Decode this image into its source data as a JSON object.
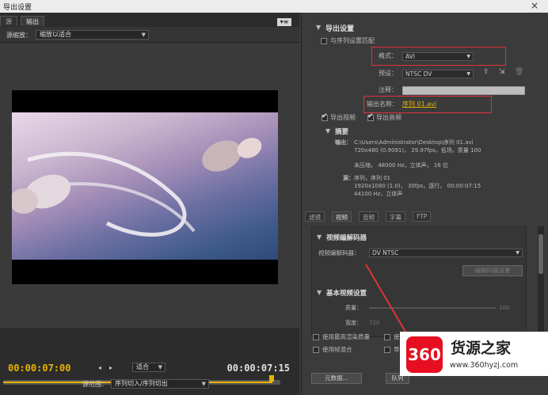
{
  "window": {
    "title": "导出设置",
    "close": "×"
  },
  "left": {
    "tabs": [
      "源",
      "输出"
    ],
    "source_scaling": {
      "label": "源缩放：",
      "value": "缩放以适合"
    },
    "controls": {
      "timecode_in": "00:00:07:00",
      "timecode_out": "00:00:07:15",
      "fit": "适合",
      "range_label": "源范围：",
      "range_value": "序列切入/序列切出"
    }
  },
  "export_settings": {
    "header": "导出设置",
    "match_sequence": "与序列设置匹配",
    "format_label": "格式：",
    "format_value": "AVI",
    "preset_label": "预设：",
    "preset_value": "NTSC DV",
    "comment_label": "注释：",
    "output_name_label": "输出名称：",
    "output_name_value": "序列 01.avi",
    "export_video": "导出视频",
    "export_audio": "导出音频"
  },
  "summary": {
    "header": "摘要",
    "output_label": "输出：",
    "output_lines": [
      "C:\\Users\\Administrator\\Desktop\\序列 01.avi",
      "720x480 (0.9091)， 29.97fps，低场，质量 100",
      "",
      "未压缩， 48000 Hz，立体声， 16 位"
    ],
    "source_label": "源：",
    "source_lines": [
      "序列，序列 01",
      "1920x1080 (1.0)， 30fps，逐行， 00:00:07:15",
      "44100 Hz，立体声"
    ]
  },
  "tabs": [
    "滤镜",
    "视频",
    "音频",
    "字幕",
    "FTP"
  ],
  "video_codec": {
    "header": "视频编解码器",
    "codec_label": "视频编解码器：",
    "codec_value": "DV NTSC",
    "codec_settings_button": "编解码器设置"
  },
  "basic_video": {
    "header": "基本视频设置",
    "quality_label": "质量：",
    "quality_value": "100",
    "width_label": "宽度：",
    "width_value": "720"
  },
  "bottom_options": [
    "使用最高渲染质量",
    "使用",
    "使用帧混合",
    "导入"
  ],
  "buttons": {
    "metadata": "元数据...",
    "queue": "队列"
  },
  "watermark": {
    "logo": "360",
    "name": "货源之家",
    "url": "www.360hyzj.com"
  },
  "colors": {
    "accent": "#e8b400",
    "highlight": "#e0323a",
    "panel": "#3b3b3b"
  }
}
